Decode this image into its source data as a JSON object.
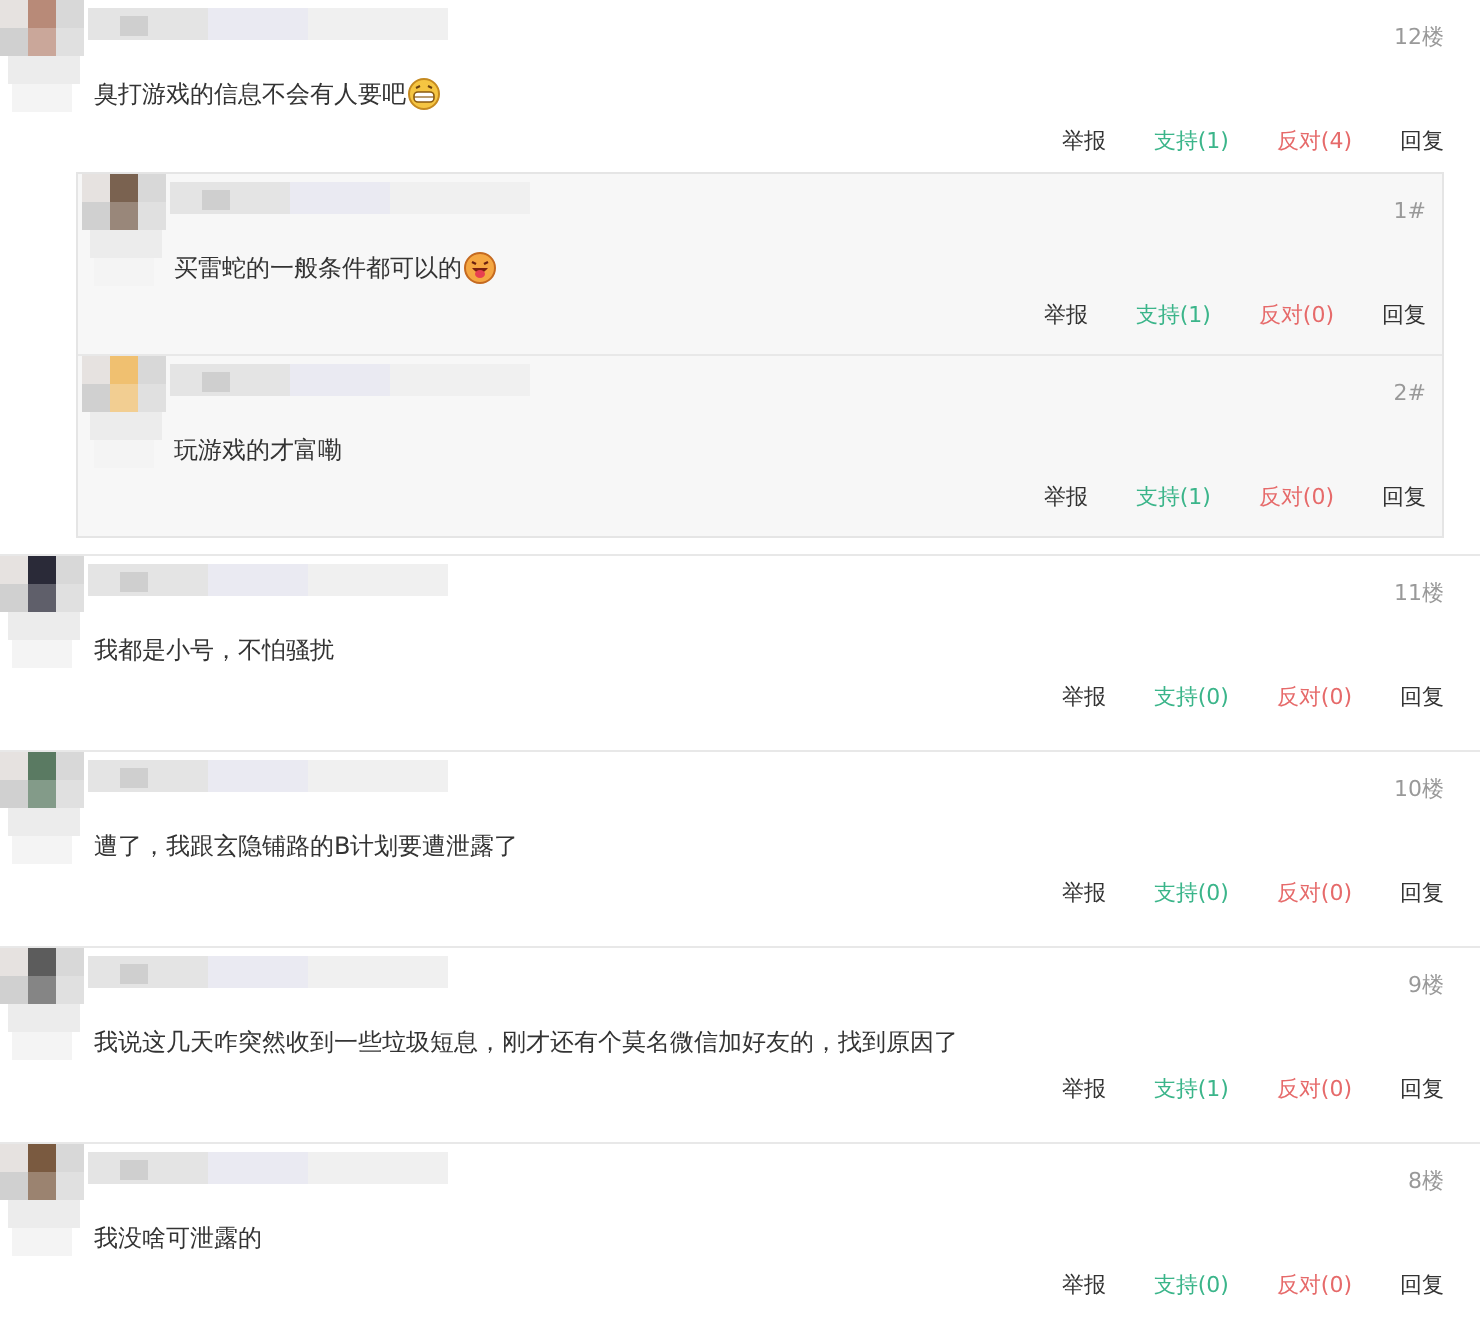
{
  "comments": [
    {
      "floor": "12楼",
      "text": "臭打游戏的信息不会有人要吧",
      "emoji": {
        "kind": "grin"
      },
      "actions": {
        "report": "举报",
        "support": "支持(1)",
        "oppose": "反对(4)",
        "reply": "回复"
      },
      "replies": [
        {
          "floor": "1#",
          "text": "买雷蛇的一般条件都可以的",
          "emoji": {
            "kind": "tongue"
          },
          "actions": {
            "report": "举报",
            "support": "支持(1)",
            "oppose": "反对(0)",
            "reply": "回复"
          }
        },
        {
          "floor": "2#",
          "text": "玩游戏的才富嘞",
          "actions": {
            "report": "举报",
            "support": "支持(1)",
            "oppose": "反对(0)",
            "reply": "回复"
          }
        }
      ]
    },
    {
      "floor": "11楼",
      "text": "我都是小号，不怕骚扰",
      "actions": {
        "report": "举报",
        "support": "支持(0)",
        "oppose": "反对(0)",
        "reply": "回复"
      }
    },
    {
      "floor": "10楼",
      "text": "遭了，我跟玄隐铺路的B计划要遭泄露了",
      "actions": {
        "report": "举报",
        "support": "支持(0)",
        "oppose": "反对(0)",
        "reply": "回复"
      }
    },
    {
      "floor": "9楼",
      "text": "我说这几天咋突然收到一些垃圾短息，刚才还有个莫名微信加好友的，找到原因了",
      "actions": {
        "report": "举报",
        "support": "支持(1)",
        "oppose": "反对(0)",
        "reply": "回复"
      }
    },
    {
      "floor": "8楼",
      "text": "我没啥可泄露的",
      "actions": {
        "report": "举报",
        "support": "支持(0)",
        "oppose": "反对(0)",
        "reply": "回复"
      }
    }
  ]
}
